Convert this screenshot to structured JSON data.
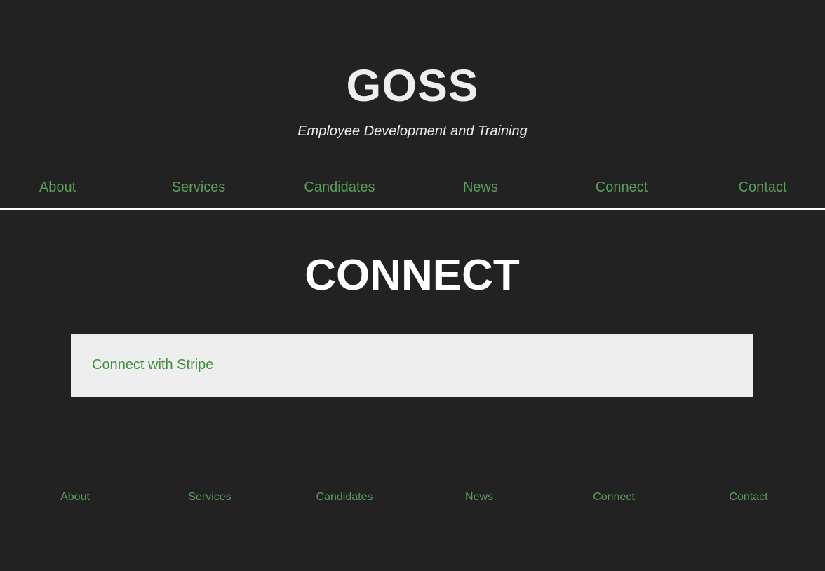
{
  "site": {
    "title": "GOSS",
    "tagline": "Employee Development and Training"
  },
  "nav": {
    "items": [
      "About",
      "Services",
      "Candidates",
      "News",
      "Connect",
      "Contact"
    ]
  },
  "main": {
    "heading": "CONNECT",
    "card_link": "Connect with Stripe"
  },
  "footer": {
    "items": [
      "About",
      "Services",
      "Candidates",
      "News",
      "Connect",
      "Contact"
    ]
  },
  "colors": {
    "background": "#222222",
    "link": "#5a9e5a",
    "card_background": "#eeeeee",
    "card_link": "#3e8f3e",
    "title": "#eeeeee"
  }
}
